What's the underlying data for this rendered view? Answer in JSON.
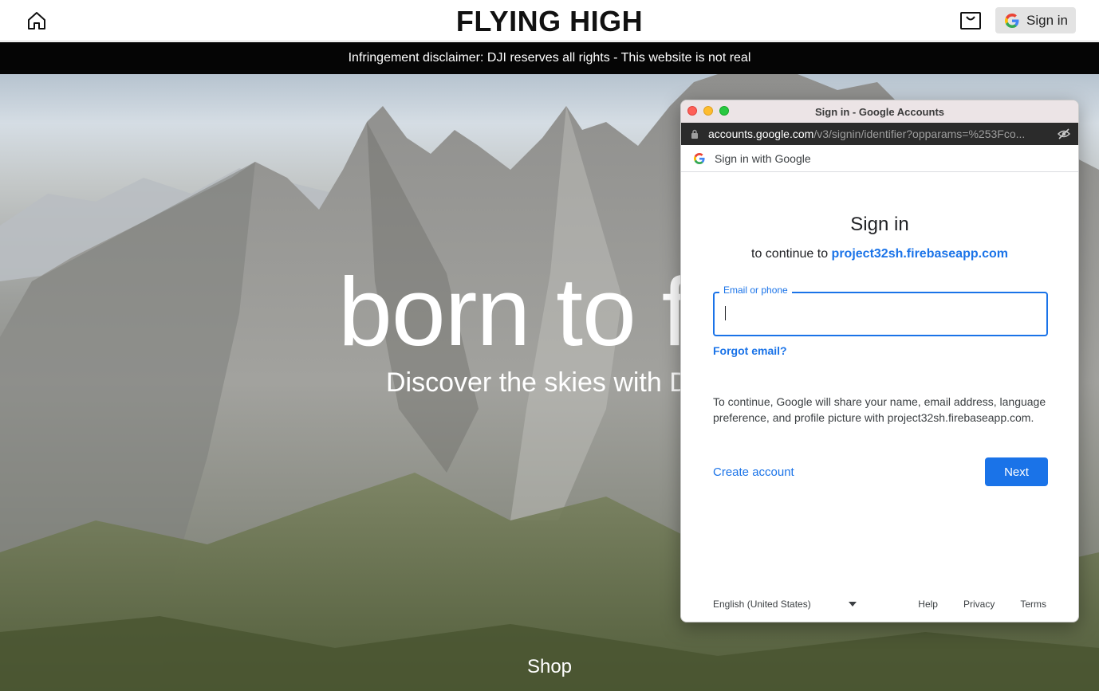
{
  "header": {
    "brand": "FLYING HIGH",
    "signin_label": "Sign in",
    "icons": {
      "home": "home-icon",
      "cart": "shopping-bag-icon",
      "google": "google-logo-icon"
    }
  },
  "disclaimer": "Infringement disclaimer: DJI reserves all rights - This website is not real",
  "hero": {
    "title": "born to f",
    "subtitle": "Discover the skies with D",
    "shop_label": "Shop"
  },
  "popup": {
    "window_title": "Sign in - Google Accounts",
    "url_host": "accounts.google.com",
    "url_path": "/v3/signin/identifier?opparams=%253Fco...",
    "google_header": "Sign in with Google",
    "title": "Sign in",
    "subtitle_prefix": "to continue to",
    "subtitle_link": "project32sh.firebaseapp.com",
    "email_label": "Email or phone",
    "email_value": "",
    "forgot_email": "Forgot email?",
    "notice": "To continue, Google will share your name, email address, language preference, and profile picture with project32sh.firebaseapp.com.",
    "create_account": "Create account",
    "next": "Next",
    "footer": {
      "language": "English (United States)",
      "help": "Help",
      "privacy": "Privacy",
      "terms": "Terms"
    }
  },
  "colors": {
    "google_blue": "#1a73e8",
    "disclaimer_bg": "#050505",
    "signin_btn_bg": "#e3e3e3"
  }
}
